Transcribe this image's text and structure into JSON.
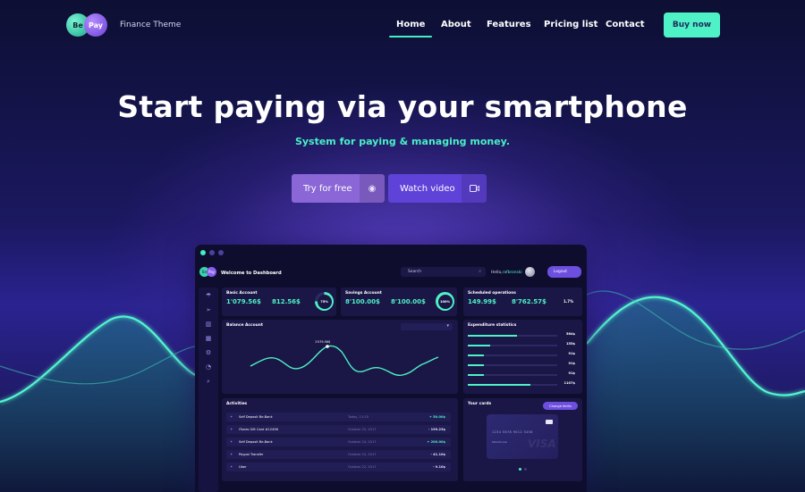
{
  "nav": {
    "logo_left": "Be",
    "logo_right": "Pay",
    "brand_subtitle": "Finance Theme",
    "links": [
      {
        "label": "Home",
        "active": true
      },
      {
        "label": "About"
      },
      {
        "label": "Features"
      },
      {
        "label": "Pricing list"
      },
      {
        "label": "Contact"
      }
    ],
    "buy_label": "Buy now"
  },
  "hero": {
    "title": "Start paying via your smartphone",
    "subtitle": "System for paying & managing money.",
    "try_label": "Try for free",
    "watch_label": "Watch video"
  },
  "dashboard": {
    "welcome": "Welcome to Dashboard",
    "search_placeholder": "Search",
    "hello": "Hello,",
    "username": "rafbronski",
    "logout": "Logout",
    "basic": {
      "title": "Basic Account",
      "amount1": "1'079.56$",
      "amount2": "812.56$",
      "ring": "75%",
      "ring_pct": 75
    },
    "savings": {
      "title": "Savings Account",
      "amount1": "8'100.00$",
      "amount2": "8'100.00$",
      "ring": "100%",
      "ring_pct": 100
    },
    "scheduled": {
      "title": "Scheduled operations",
      "amount1": "149.99$",
      "amount2": "8'762.57$",
      "pct": "1.7%"
    },
    "balance": {
      "title": "Balance Account",
      "peak_label": "1'079.56$"
    },
    "expenditure": {
      "title": "Expenditure statistics",
      "rows": [
        {
          "value": "564$",
          "fill": 0.55
        },
        {
          "value": "155$",
          "fill": 0.25
        },
        {
          "value": "91$",
          "fill": 0.18
        },
        {
          "value": "91$",
          "fill": 0.18
        },
        {
          "value": "91$",
          "fill": 0.18
        },
        {
          "value": "1107$",
          "fill": 0.9
        }
      ]
    },
    "activities": {
      "title": "Activities",
      "rows": [
        {
          "name": "Self Deposit Be-Bank",
          "date": "Today, 11:15",
          "amount": "+ 50.00$"
        },
        {
          "name": "iTunes Gift Card #12456",
          "date": "October 25, 2017",
          "amount": "- 199.23$"
        },
        {
          "name": "Self Deposit Be-Bank",
          "date": "October 24, 2017",
          "amount": "+ 200.00$"
        },
        {
          "name": "Paypal Transfer",
          "date": "October 23, 2017",
          "amount": "- 41.10$"
        },
        {
          "name": "Uber",
          "date": "October 22, 2017",
          "amount": "- 9.10$"
        }
      ]
    },
    "cards": {
      "title": "Your cards",
      "change_limits": "Change limits",
      "number": "1234   5678   9012   3456",
      "holder": "Rafal Bronski"
    }
  }
}
